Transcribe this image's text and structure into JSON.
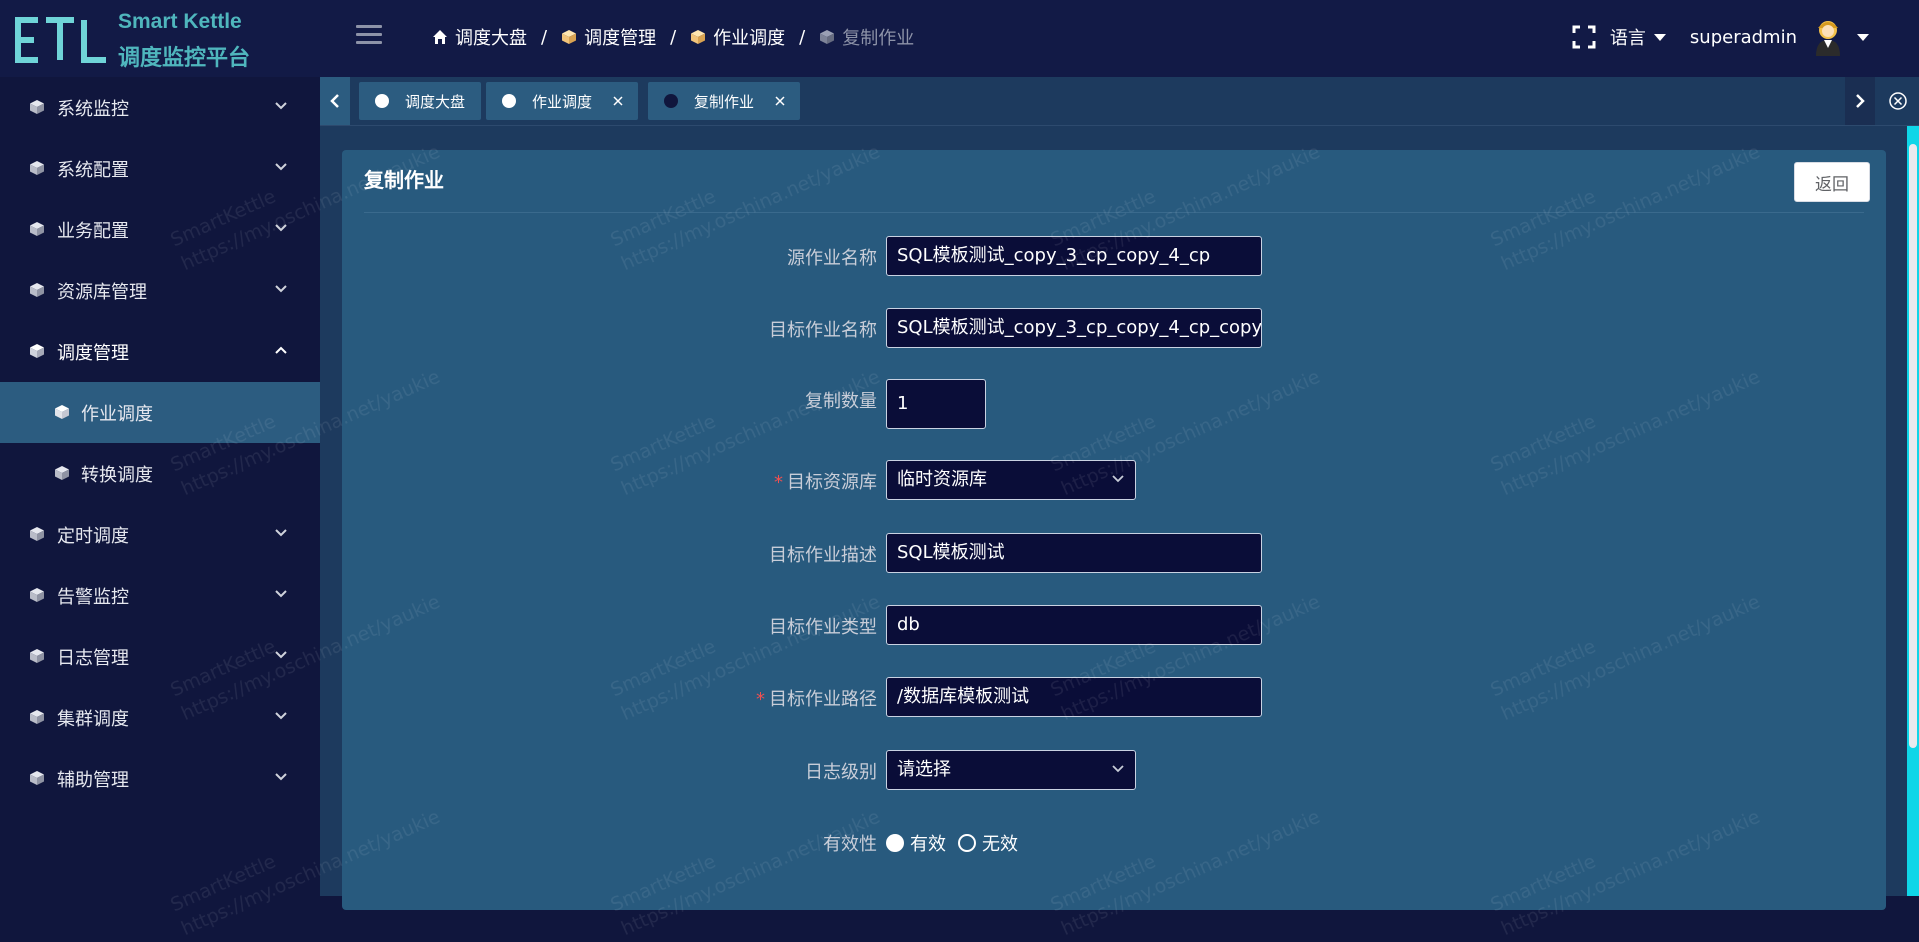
{
  "header": {
    "logo_text": "ETL",
    "app_name": "Smart Kettle",
    "app_subtitle": "调度监控平台",
    "breadcrumb": [
      "调度大盘",
      "调度管理",
      "作业调度",
      "复制作业"
    ],
    "breadcrumb_separator": "/",
    "language_label": "语言",
    "username": "superadmin"
  },
  "sidebar": {
    "items": [
      {
        "label": "系统监控",
        "icon": "cube-icon",
        "expanded": false
      },
      {
        "label": "系统配置",
        "icon": "cube-icon",
        "expanded": false
      },
      {
        "label": "业务配置",
        "icon": "cube-icon",
        "expanded": false
      },
      {
        "label": "资源库管理",
        "icon": "cube-icon",
        "expanded": false
      },
      {
        "label": "调度管理",
        "icon": "cube-icon",
        "expanded": true,
        "children": [
          {
            "label": "作业调度",
            "active": true
          },
          {
            "label": "转换调度",
            "active": false
          }
        ]
      },
      {
        "label": "定时调度",
        "icon": "cube-icon",
        "expanded": false
      },
      {
        "label": "告警监控",
        "icon": "cube-icon",
        "expanded": false
      },
      {
        "label": "日志管理",
        "icon": "cube-icon",
        "expanded": false
      },
      {
        "label": "集群调度",
        "icon": "cube-icon",
        "expanded": false
      },
      {
        "label": "辅助管理",
        "icon": "cube-icon",
        "expanded": false
      }
    ]
  },
  "tabs": [
    {
      "label": "调度大盘",
      "closable": false,
      "current": false
    },
    {
      "label": "作业调度",
      "closable": true,
      "current": false
    },
    {
      "label": "复制作业",
      "closable": true,
      "current": true
    }
  ],
  "page": {
    "title": "复制作业",
    "back_label": "返回"
  },
  "form": {
    "source_job_name": {
      "label": "源作业名称",
      "value": "SQL模板测试_copy_3_cp_copy_4_cp"
    },
    "target_job_name": {
      "label": "目标作业名称",
      "value": "SQL模板测试_copy_3_cp_copy_4_cp_copy"
    },
    "copy_count": {
      "label": "复制数量",
      "value": "1"
    },
    "target_repository": {
      "label": "目标资源库",
      "required": true,
      "value": "临时资源库"
    },
    "target_job_description": {
      "label": "目标作业描述",
      "value": "SQL模板测试"
    },
    "target_job_type": {
      "label": "目标作业类型",
      "value": "db"
    },
    "target_job_path": {
      "label": "目标作业路径",
      "required": true,
      "value": "/数据库模板测试"
    },
    "log_level": {
      "label": "日志级别",
      "placeholder": "请选择"
    },
    "validity": {
      "label": "有效性",
      "options": [
        "有效",
        "无效"
      ],
      "selected": "有效"
    }
  },
  "watermark": {
    "line1": "SmartKettle",
    "line2": "https://my.oschina.net/yaukie"
  },
  "colors": {
    "accent": "#4fb6bd",
    "sidebar_bg": "#10163d",
    "active_bg": "#2c5c80",
    "card_bg": "#285a7e",
    "required": "#f05050"
  }
}
